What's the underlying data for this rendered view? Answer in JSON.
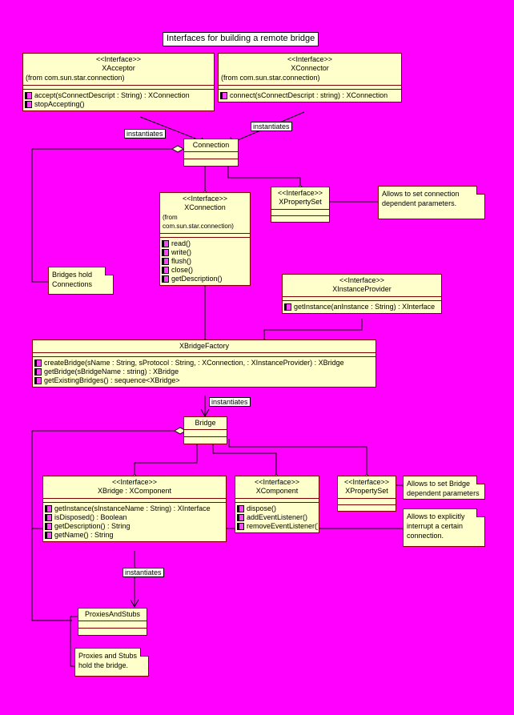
{
  "diagram": {
    "title": "Interfaces for building a remote bridge",
    "colors": {
      "background": "#FF00FF",
      "box_fill": "#FFFFCC",
      "box_border": "#800000",
      "label_fill": "#FFFFFF",
      "text": "#000000"
    }
  },
  "classes": {
    "xacceptor": {
      "stereotype": "<<Interface>>",
      "name": "XAcceptor",
      "package": "(from com.sun.star.connection)",
      "operations": [
        "accept(sConnectDescript : String) : XConnection",
        "stopAccepting()"
      ]
    },
    "xconnector": {
      "stereotype": "<<Interface>>",
      "name": "XConnector",
      "package": "(from com.sun.star.connection)",
      "operations": [
        "connect(sConnectDescript : string) : XConnection"
      ]
    },
    "connection": {
      "stereotype": "",
      "name": "Connection",
      "package": "",
      "operations": []
    },
    "xconnection": {
      "stereotype": "<<Interface>>",
      "name": "XConnection",
      "package": "(from com.sun.star.connection)",
      "operations": [
        "read()",
        "write()",
        "flush()",
        "close()",
        "getDescription()"
      ]
    },
    "xpropertyset_conn": {
      "stereotype": "<<Interface>>",
      "name": "XPropertySet",
      "package": "",
      "operations": []
    },
    "xinstanceprovider": {
      "stereotype": "<<Interface>>",
      "name": "XInstanceProvider",
      "package": "",
      "operations": [
        "getInstance(anInstance : String) : XInterface"
      ]
    },
    "xbridgefactory": {
      "stereotype": "",
      "name": "XBridgeFactory",
      "package": "",
      "operations": [
        "createBridge(sName : String, sProtocol : String,  : XConnection,  : XInstanceProvider) : XBridge",
        "getBridge(sBridgeName : string) : XBridge",
        "getExistingBridges() : sequence<XBridge>"
      ]
    },
    "bridge": {
      "stereotype": "",
      "name": "Bridge",
      "package": "",
      "operations": []
    },
    "xbridge": {
      "stereotype": "<<Interface>>",
      "name": "XBridge : XComponent",
      "package": "",
      "operations": [
        "getInstance(sInstanceName : String) : XInterface",
        "isDisposed() : Boolean",
        "getDescription() : String",
        "getName() : String"
      ]
    },
    "xcomponent": {
      "stereotype": "<<Interface>>",
      "name": "XComponent",
      "package": "",
      "operations": [
        "dispose()",
        "addEventListener()",
        "removeEventListener()"
      ]
    },
    "xpropertyset_bridge": {
      "stereotype": "<<Interface>>",
      "name": "XPropertySet",
      "package": "",
      "operations": []
    },
    "proxiesandstubs": {
      "stereotype": "",
      "name": "ProxiesAndStubs",
      "package": "",
      "operations": []
    }
  },
  "notes": {
    "connection_params": "Allows to set connection dependent parameters.",
    "bridges_hold": "Bridges hold Connections",
    "bridge_params": "Allows to set Bridge dependent parameters",
    "interrupt": "Allows to explicitly interrupt a certain connection.",
    "proxies_hold": "Proxies and Stubs hold the bridge."
  },
  "edge_labels": {
    "instantiates_acceptor": "instantiates",
    "instantiates_connector": "instantiates",
    "instantiates_bridge": "instantiates",
    "instantiates_proxies": "instantiates"
  }
}
